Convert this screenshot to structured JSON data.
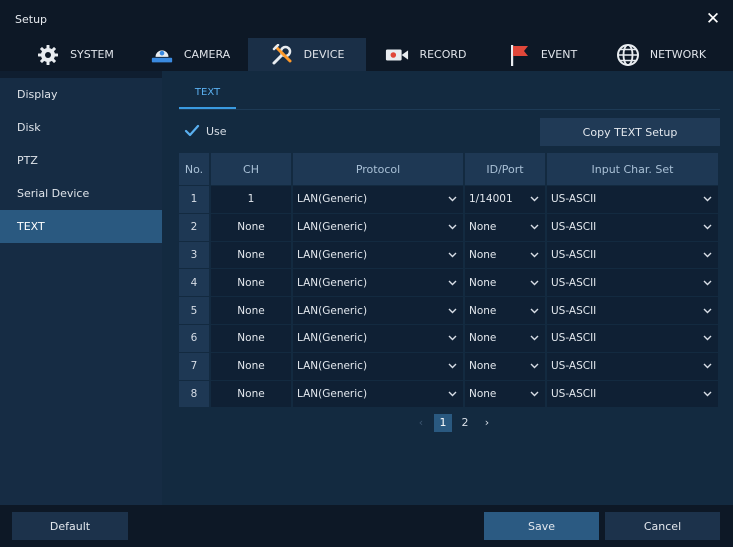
{
  "window": {
    "title": "Setup",
    "close_glyph": "✕"
  },
  "tabs": [
    {
      "label": "SYSTEM",
      "icon": "gear-icon"
    },
    {
      "label": "CAMERA",
      "icon": "camera-icon"
    },
    {
      "label": "DEVICE",
      "icon": "tools-icon",
      "active": true
    },
    {
      "label": "RECORD",
      "icon": "record-icon"
    },
    {
      "label": "EVENT",
      "icon": "flag-icon"
    },
    {
      "label": "NETWORK",
      "icon": "globe-icon"
    }
  ],
  "sidebar": {
    "items": [
      {
        "label": "Display"
      },
      {
        "label": "Disk"
      },
      {
        "label": "PTZ"
      },
      {
        "label": "Serial Device"
      },
      {
        "label": "TEXT",
        "active": true
      }
    ]
  },
  "content": {
    "subtab": "TEXT",
    "use_label": "Use",
    "use_checked": true,
    "copy_button": "Copy TEXT Setup",
    "columns": [
      "No.",
      "CH",
      "Protocol",
      "ID/Port",
      "Input Char. Set"
    ],
    "rows": [
      {
        "no": "1",
        "ch": "1",
        "protocol": "LAN(Generic)",
        "port": "1/14001",
        "charset": "US-ASCII"
      },
      {
        "no": "2",
        "ch": "None",
        "protocol": "LAN(Generic)",
        "port": "None",
        "charset": "US-ASCII"
      },
      {
        "no": "3",
        "ch": "None",
        "protocol": "LAN(Generic)",
        "port": "None",
        "charset": "US-ASCII"
      },
      {
        "no": "4",
        "ch": "None",
        "protocol": "LAN(Generic)",
        "port": "None",
        "charset": "US-ASCII"
      },
      {
        "no": "5",
        "ch": "None",
        "protocol": "LAN(Generic)",
        "port": "None",
        "charset": "US-ASCII"
      },
      {
        "no": "6",
        "ch": "None",
        "protocol": "LAN(Generic)",
        "port": "None",
        "charset": "US-ASCII"
      },
      {
        "no": "7",
        "ch": "None",
        "protocol": "LAN(Generic)",
        "port": "None",
        "charset": "US-ASCII"
      },
      {
        "no": "8",
        "ch": "None",
        "protocol": "LAN(Generic)",
        "port": "None",
        "charset": "US-ASCII"
      }
    ],
    "pagination": {
      "prev": "‹",
      "pages": [
        "1",
        "2"
      ],
      "current": "1",
      "next": "›"
    }
  },
  "footer": {
    "default_label": "Default",
    "save_label": "Save",
    "cancel_label": "Cancel"
  },
  "colors": {
    "accent": "#2a5980",
    "tab_active": "#1a2f47",
    "check": "#5ab0f0",
    "flag": "#e0473a"
  }
}
